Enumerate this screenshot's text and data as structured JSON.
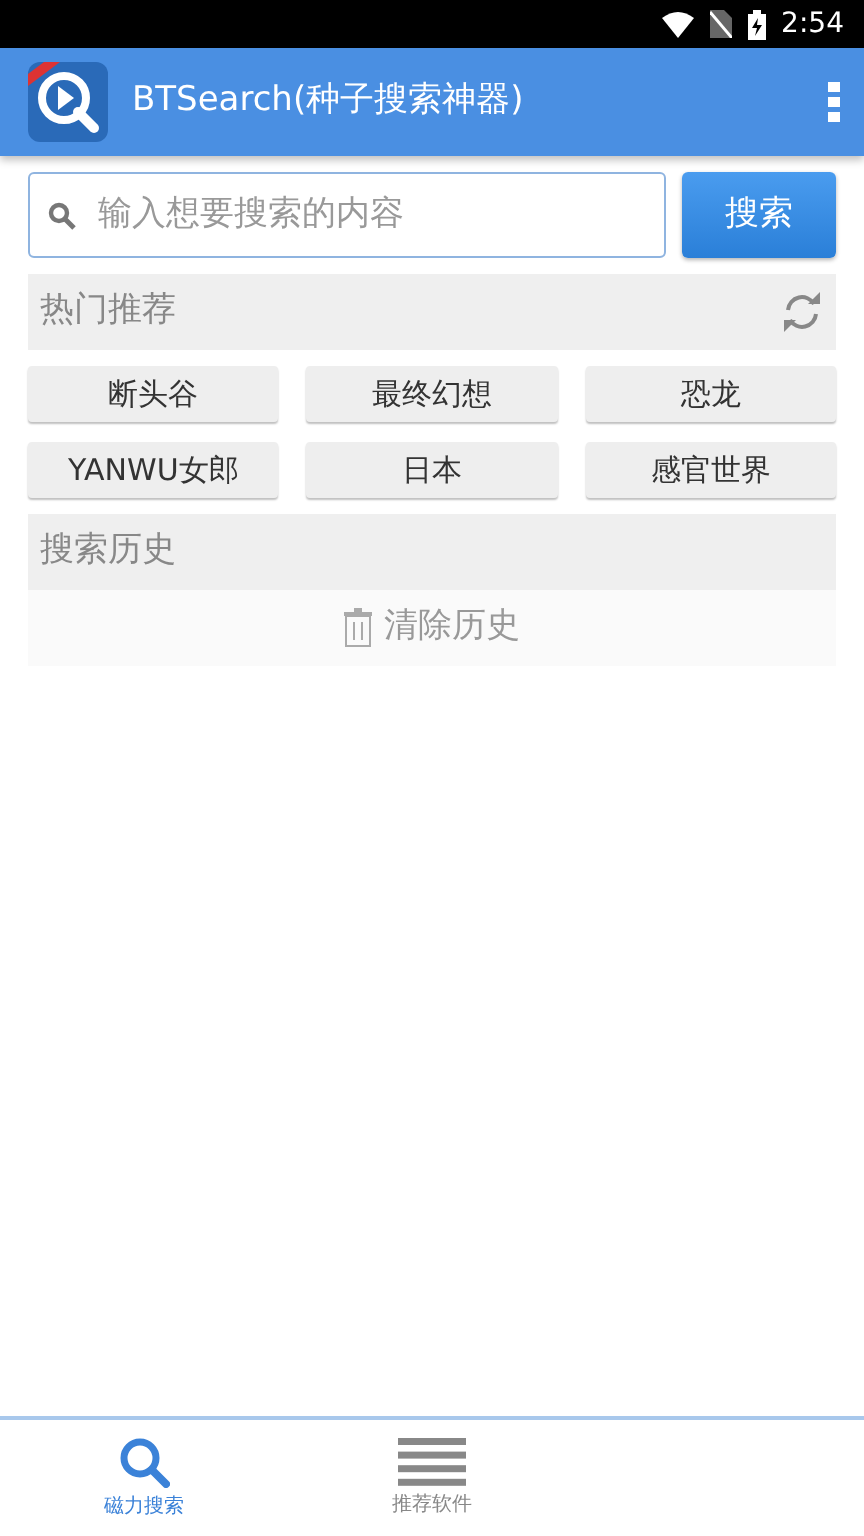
{
  "status_bar": {
    "time": "2:54"
  },
  "app_bar": {
    "title": "BTSearch(种子搜索神器)"
  },
  "search": {
    "placeholder": "输入想要搜索的内容",
    "button": "搜索"
  },
  "hot": {
    "title": "热门推荐",
    "tags": [
      "断头谷",
      "最终幻想",
      "恐龙",
      "YANWU女郎",
      "日本",
      "感官世界"
    ]
  },
  "history": {
    "title": "搜索历史",
    "clear": "清除历史"
  },
  "bottom_tabs": [
    {
      "label": "磁力搜索",
      "kind": "search",
      "selected": true
    },
    {
      "label": "推荐软件",
      "kind": "list",
      "selected": false
    }
  ]
}
